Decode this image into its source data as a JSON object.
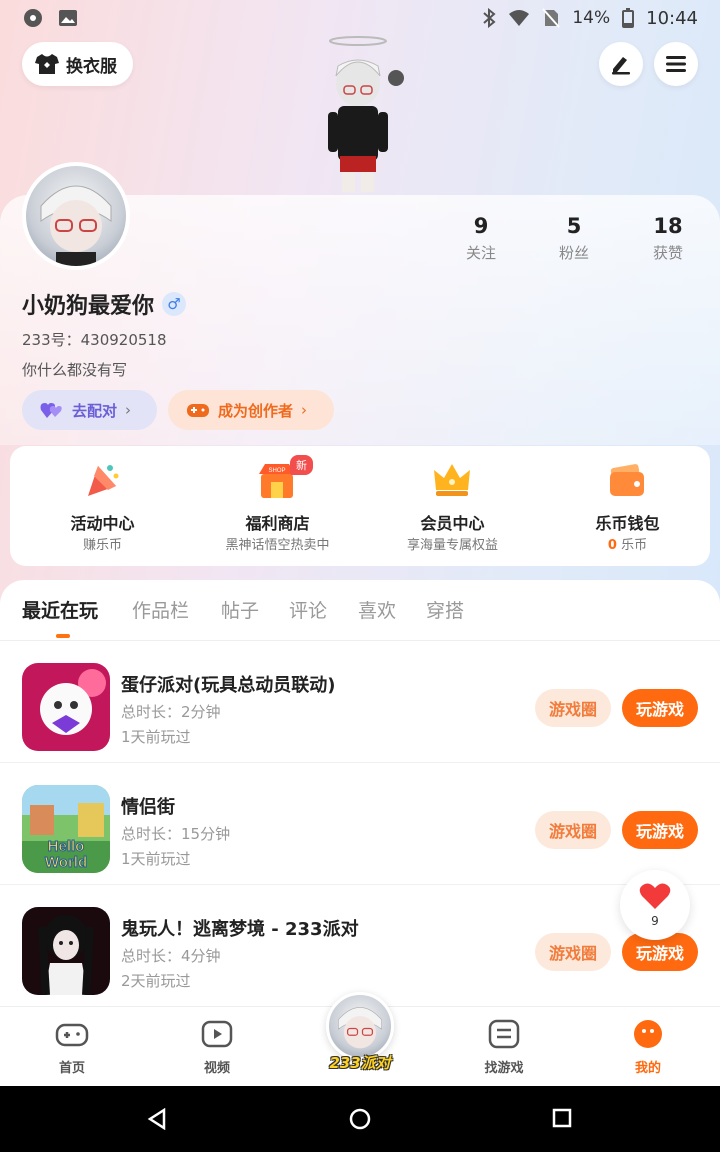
{
  "status_bar": {
    "battery": "14%",
    "time": "10:44"
  },
  "header": {
    "outfit_label": "换衣服"
  },
  "profile": {
    "stats": [
      {
        "value": "9",
        "label": "关注"
      },
      {
        "value": "5",
        "label": "粉丝"
      },
      {
        "value": "18",
        "label": "获赞"
      }
    ],
    "nickname": "小奶狗最爱你",
    "gender_symbol": "♂",
    "uid": "233号：430920518",
    "bio": "你什么都没有写",
    "match_label": "去配对",
    "creator_label": "成为创作者"
  },
  "quick_actions": [
    {
      "title": "活动中心",
      "subtitle": "赚乐币"
    },
    {
      "title": "福利商店",
      "subtitle": "黑神话悟空热卖中",
      "badge": "新"
    },
    {
      "title": "会员中心",
      "subtitle": "享海量专属权益"
    },
    {
      "title": "乐币钱包",
      "subtitle_value": "0",
      "subtitle_unit": "乐币"
    }
  ],
  "tabs": [
    "最近在玩",
    "作品栏",
    "帖子",
    "评论",
    "喜欢",
    "穿搭"
  ],
  "games": [
    {
      "title": "蛋仔派对(玩具总动员联动)",
      "duration": "总时长：2分钟",
      "last_played": "1天前玩过"
    },
    {
      "title": "情侣街",
      "duration": "总时长：15分钟",
      "last_played": "1天前玩过"
    },
    {
      "title": "鬼玩人！逃离梦境 - 233派对",
      "duration": "总时长：4分钟",
      "last_played": "2天前玩过"
    }
  ],
  "game_buttons": {
    "circle": "游戏圈",
    "play": "玩游戏"
  },
  "like_count": "9",
  "bottom_nav": [
    {
      "label": "首页",
      "icon": "gamepad-icon"
    },
    {
      "label": "视频",
      "icon": "video-icon"
    },
    {
      "label": "233派对",
      "icon": "avatar"
    },
    {
      "label": "找游戏",
      "icon": "list-icon"
    },
    {
      "label": "我的",
      "icon": "profile-icon"
    }
  ],
  "colors": {
    "accent": "#ff6a10",
    "match": "#6b5fd6",
    "badge": "#f24e4e"
  }
}
